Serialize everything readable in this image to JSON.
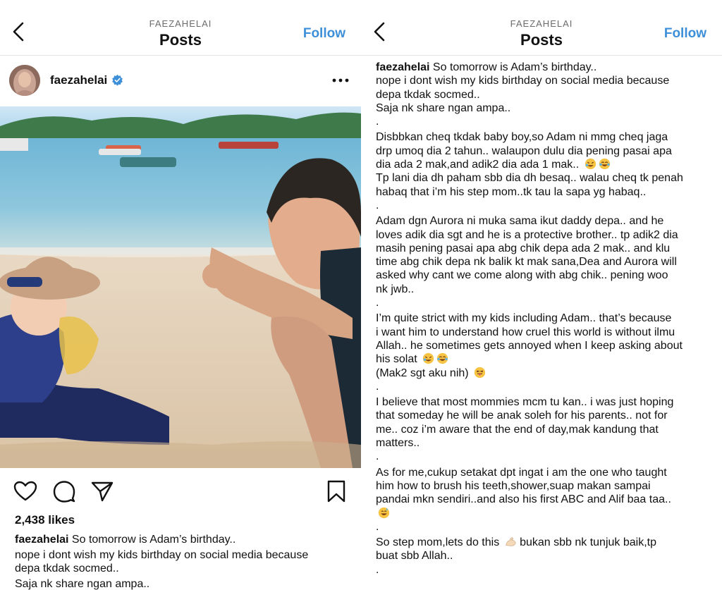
{
  "header": {
    "username": "FAEZAHELAI",
    "title": "Posts",
    "follow_label": "Follow"
  },
  "post": {
    "username": "faezahelai",
    "likes": "2,438 likes",
    "caption_preview": [
      {
        "user": "faezahelai",
        "text": " So tomorrow is Adam’s birthday.."
      },
      {
        "text": "nope i dont wish my kids birthday on social media because"
      },
      {
        "text": "depa tkdak socmed.."
      },
      {
        "text": "Saja nk share ngan ampa.."
      }
    ]
  },
  "caption_full": [
    {
      "user": "faezahelai",
      "text": " So tomorrow is Adam’s birthday.."
    },
    {
      "text": "nope i dont wish my kids birthday on social media because"
    },
    {
      "text": "depa tkdak socmed.."
    },
    {
      "text": "Saja nk share ngan ampa.."
    },
    {
      "text": "."
    },
    {
      "text": "Disbbkan cheq tkdak baby boy,so Adam ni mmg cheq jaga"
    },
    {
      "text": "drp umoq dia 2 tahun.. walaupon dulu dia pening pasai apa"
    },
    {
      "text": "dia ada 2 mak,and adik2 dia ada 1 mak.. ",
      "emoji": [
        "rofl",
        "joy"
      ]
    },
    {
      "text": "Tp lani dia dh paham sbb dia dh besaq.. walau cheq tk penah"
    },
    {
      "text": "habaq that i’m his step mom..tk tau la sapa yg habaq.."
    },
    {
      "text": "."
    },
    {
      "text": "Adam dgn Aurora ni muka sama ikut daddy depa.. and he"
    },
    {
      "text": "loves adik dia sgt and he is a protective brother.. tp adik2 dia"
    },
    {
      "text": "masih pening pasai apa abg chik depa ada 2 mak.. and klu"
    },
    {
      "text": "time abg chik depa nk balik kt mak sana,Dea and Aurora will"
    },
    {
      "text": "asked why cant we come along with abg chik.. pening woo"
    },
    {
      "text": "nk jwb.."
    },
    {
      "text": "."
    },
    {
      "text": "I’m quite strict with my kids including Adam.. that’s because"
    },
    {
      "text": "i want him to understand how cruel this world is without ilmu"
    },
    {
      "text": "Allah.. he sometimes gets annoyed when I keep asking about"
    },
    {
      "text": "his solat ",
      "emoji": [
        "rofl",
        "joy"
      ]
    },
    {
      "text": "(Mak2 sgt aku nih) ",
      "emoji": [
        "tongue"
      ]
    },
    {
      "text": "."
    },
    {
      "text": "I believe that most mommies mcm tu kan.. i was just hoping"
    },
    {
      "text": "that someday he will be anak soleh for his parents.. not for"
    },
    {
      "text": "me.. coz i’m aware that the end of day,mak kandung that"
    },
    {
      "text": "matters.."
    },
    {
      "text": "."
    },
    {
      "text": "As for me,cukup setakat dpt ingat i am the one who taught"
    },
    {
      "text": "him how to brush his teeth,shower,suap makan sampai"
    },
    {
      "text": "pandai mkn sendiri..and also his first ABC and Alif baa taa.."
    },
    {
      "text": "",
      "emoji": [
        "sweat-smile"
      ]
    },
    {
      "text": "."
    },
    {
      "text": "So step mom,lets do this ",
      "emoji": [
        "flexed-biceps"
      ],
      "text_after": " bukan sbb nk tunjuk baik,tp"
    },
    {
      "text": "buat sbb Allah.."
    },
    {
      "text": "."
    }
  ],
  "icons": {
    "back": "chevron-left-icon",
    "verified": "verified-badge-icon",
    "more": "more-horizontal-icon",
    "like": "heart-icon",
    "comment": "comment-icon",
    "share": "send-icon",
    "save": "bookmark-icon"
  },
  "colors": {
    "follow": "#3d8fd8",
    "verified": "#3d8fd8",
    "text": "#111111",
    "muted": "#6b6b6b"
  }
}
